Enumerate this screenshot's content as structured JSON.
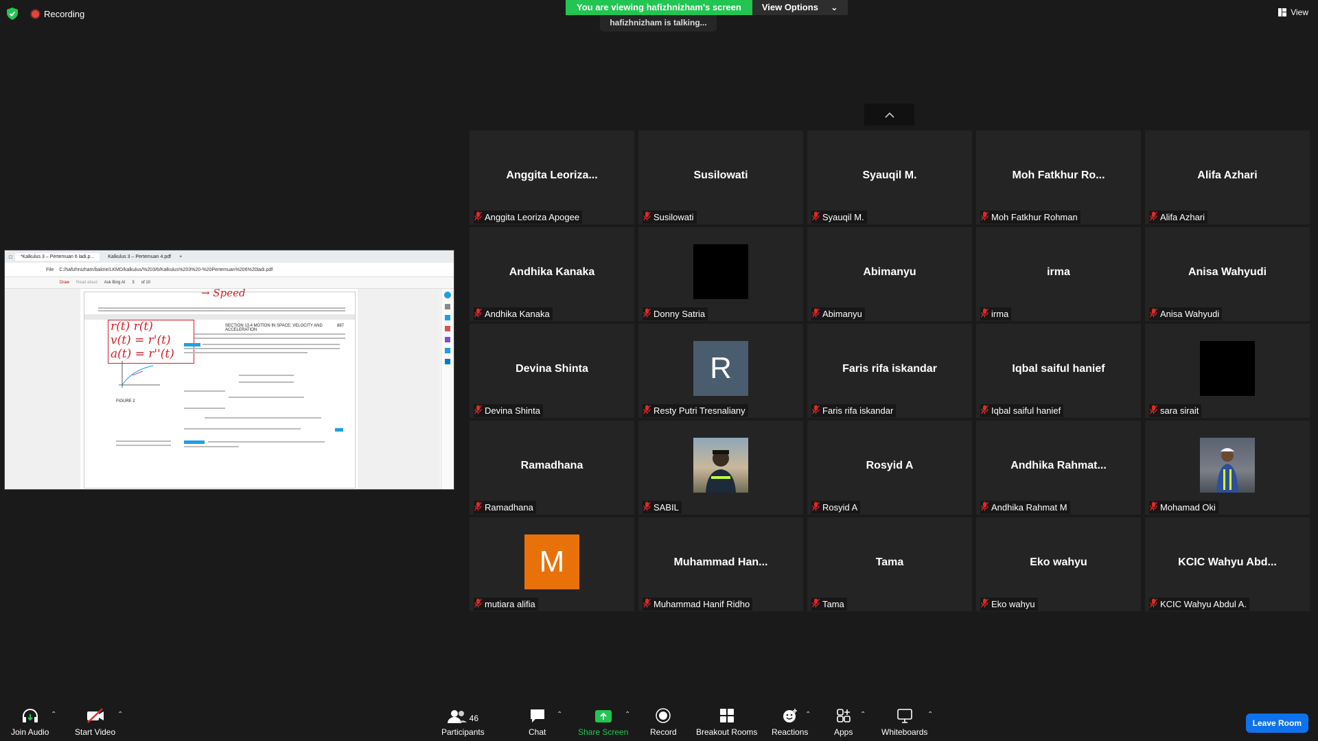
{
  "top": {
    "recording_label": "Recording",
    "viewing_banner": "You are viewing hafizhnizham's screen",
    "view_options_label": "View Options",
    "talking_indicator": "hafizhnizham is talking...",
    "view_label": "View"
  },
  "share": {
    "tab1": "*Kalkulus 3 – Pertemuan 6 ladi.p...",
    "tab2": "Kalkulus 3 – Pertemuan 4.pdf",
    "address_prefix": "File",
    "address": "C:/hafizhnizham/bakrie/LKMD/kalkulus/%203/6/Kalkulus%203%20-%20Pertemuan%206%20ladi.pdf",
    "draw_label": "Draw",
    "read_aloud": "Read aloud",
    "ask_bing": "Ask Bing AI",
    "page_num": "3",
    "page_total": "of 10",
    "section_header": "SECTION 13.4   MOTION IN SPACE: VELOCITY AND ACCELERATION",
    "page_no": "887",
    "ink_lines": [
      "r(t)  r(t)",
      "v(t) = r'(t)",
      "a(t) = r''(t)"
    ],
    "ink_speed": "→ Speed",
    "figure_label": "FIGURE 2"
  },
  "grid": {
    "participants": [
      {
        "big": "Anggita  Leoriza...",
        "name": "Anggita Leoriza Apogee"
      },
      {
        "big": "Susilowati",
        "name": "Susilowati"
      },
      {
        "big": "Syauqil M.",
        "name": "Syauqil M."
      },
      {
        "big": "Moh  Fatkhur  Ro...",
        "name": "Moh Fatkhur Rohman"
      },
      {
        "big": "Alifa Azhari",
        "name": "Alifa Azhari"
      },
      {
        "big": "Andhika Kanaka",
        "name": "Andhika Kanaka"
      },
      {
        "big": "",
        "name": "Donny Satria",
        "avatar": "black"
      },
      {
        "big": "Abimanyu",
        "name": "Abimanyu"
      },
      {
        "big": "irma",
        "name": "irma"
      },
      {
        "big": "Anisa Wahyudi",
        "name": "Anisa Wahyudi"
      },
      {
        "big": "Devina Shinta",
        "name": "Devina Shinta"
      },
      {
        "big": "",
        "name": "Resty Putri Tresnaliany",
        "avatar": "letter",
        "letter": "R",
        "color": "#4a5d6e"
      },
      {
        "big": "Faris rifa iskandar",
        "name": "Faris rifa iskandar"
      },
      {
        "big": "Iqbal saiful hanief",
        "name": "Iqbal saiful hanief"
      },
      {
        "big": "",
        "name": "sara sirait",
        "avatar": "black"
      },
      {
        "big": "Ramadhana",
        "name": "Ramadhana"
      },
      {
        "big": "",
        "name": "SABIL",
        "avatar": "photo1"
      },
      {
        "big": "Rosyid A",
        "name": "Rosyid A"
      },
      {
        "big": "Andhika  Rahmat...",
        "name": "Andhika Rahmat M"
      },
      {
        "big": "",
        "name": "Mohamad Oki",
        "avatar": "photo2"
      },
      {
        "big": "",
        "name": "mutiara alifia",
        "avatar": "letter",
        "letter": "M",
        "color": "#e8710a"
      },
      {
        "big": "Muhammad  Han...",
        "name": "Muhammad Hanif Ridho"
      },
      {
        "big": "Tama",
        "name": "Tama"
      },
      {
        "big": "Eko wahyu",
        "name": "Eko wahyu"
      },
      {
        "big": "KCIC  Wahyu  Abd...",
        "name": "KCIC Wahyu Abdul A."
      }
    ]
  },
  "toolbar": {
    "join_audio": "Join Audio",
    "start_video": "Start Video",
    "participants": "Participants",
    "participants_count": "46",
    "chat": "Chat",
    "share_screen": "Share Screen",
    "record": "Record",
    "breakout_rooms": "Breakout Rooms",
    "reactions": "Reactions",
    "apps": "Apps",
    "whiteboards": "Whiteboards",
    "leave_room": "Leave Room"
  },
  "colors": {
    "accent_green": "#23c552",
    "leave_blue": "#0e72ed",
    "mic_muted_red": "#e02828",
    "recording_red": "#e5443b"
  }
}
